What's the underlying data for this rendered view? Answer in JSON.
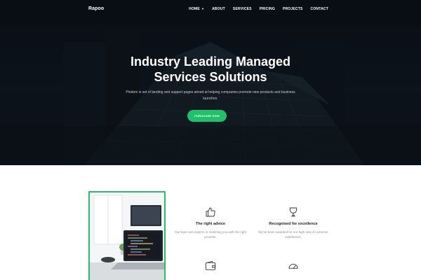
{
  "brand": {
    "logo": "Rapoo"
  },
  "nav": {
    "items": [
      {
        "label": "HOME",
        "dropdown": true
      },
      {
        "label": "ABOUT"
      },
      {
        "label": "SERVICES"
      },
      {
        "label": "PRICING"
      },
      {
        "label": "PROJECTS"
      },
      {
        "label": "CONTACT"
      }
    ]
  },
  "hero": {
    "title_line1": "Industry Leading Managed",
    "title_line2": "Services Solutions",
    "subtitle": "Pindom is set of landing and support pages aimed at helping companies promote new products and business launches.",
    "cta_label": "PURCHASE NOW"
  },
  "features": [
    {
      "icon": "thumbs-up-icon",
      "title": "The right advice",
      "desc": "Our team are experts in matching you with the right provider."
    },
    {
      "icon": "trophy-icon",
      "title": "Recognised for excellence",
      "desc": "We've been awarded for our high rate of customer satisfaction."
    },
    {
      "icon": "wallet-icon"
    },
    {
      "icon": "speedometer-icon"
    }
  ],
  "colors": {
    "accent": "#1ec26a",
    "hero_dark": "#0b1118",
    "text_dark": "#222222",
    "text_muted": "#8a8f96"
  }
}
